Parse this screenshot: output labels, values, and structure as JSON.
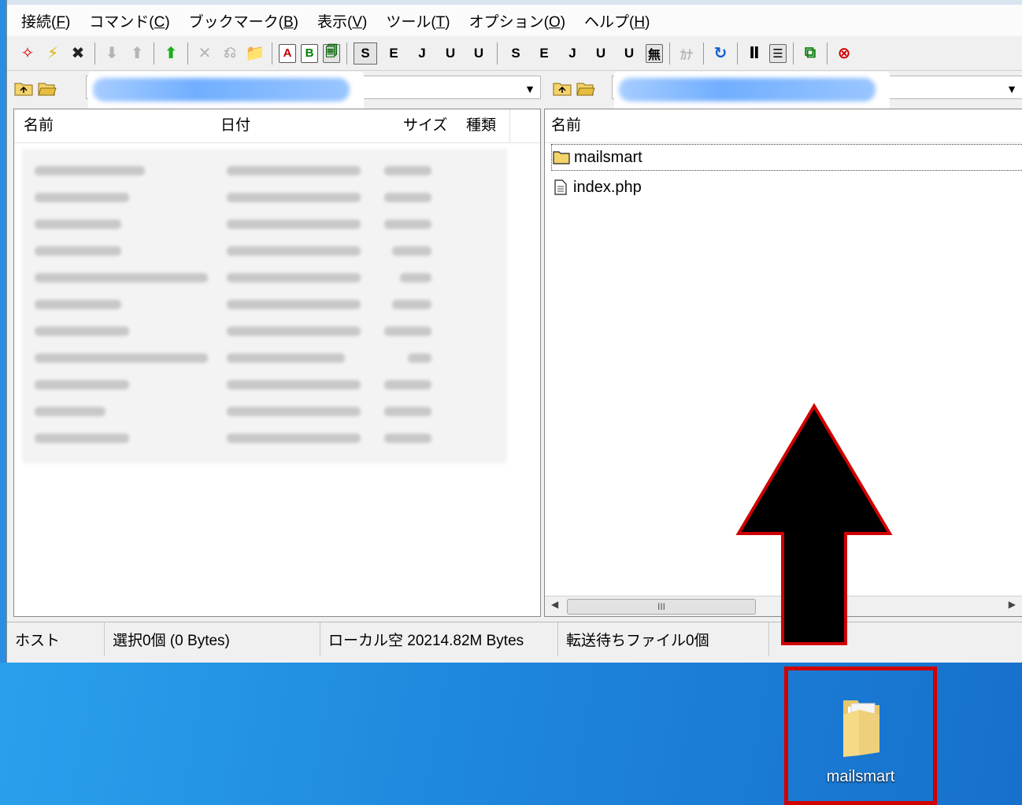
{
  "menu": [
    {
      "text": "接続(",
      "key": "F",
      "end": ")"
    },
    {
      "text": "コマンド(",
      "key": "C",
      "end": ")"
    },
    {
      "text": "ブックマーク(",
      "key": "B",
      "end": ")"
    },
    {
      "text": "表示(",
      "key": "V",
      "end": ")"
    },
    {
      "text": "ツール(",
      "key": "T",
      "end": ")"
    },
    {
      "text": "オプション(",
      "key": "O",
      "end": ")"
    },
    {
      "text": "ヘルプ(",
      "key": "H",
      "end": ")"
    }
  ],
  "toolbar": {
    "ascii_mode": "A",
    "binary_mode": "B",
    "mu_label": "無",
    "kana_label": "ｶﾅ",
    "codes": {
      "sjis": "S",
      "euc": "E",
      "jis": "J",
      "utf8": "U"
    }
  },
  "left_panel": {
    "columns": {
      "name": "名前",
      "date": "日付",
      "size": "サイズ",
      "type": "種類"
    }
  },
  "right_panel": {
    "columns": {
      "name": "名前"
    },
    "files": [
      {
        "name": "mailsmart",
        "kind": "folder"
      },
      {
        "name": "index.php",
        "kind": "file"
      }
    ],
    "scroll_thumb": "III"
  },
  "statusbar": {
    "host": "ホスト",
    "selection": "選択0個 (0 Bytes)",
    "local_free": "ローカル空 20214.82M Bytes",
    "queue": "転送待ちファイル0個"
  },
  "desktop": {
    "icon_label": "mailsmart"
  },
  "colors": {
    "highlight_red": "#d00000",
    "desktop_blue": "#1e88dc"
  }
}
